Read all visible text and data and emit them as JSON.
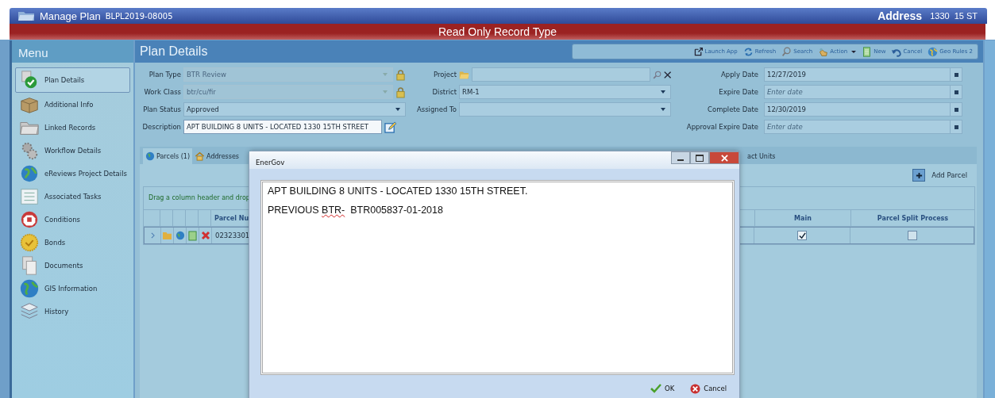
{
  "window": {
    "title": "Manage Plan",
    "record": "BLPL2019-08005",
    "address_label": "Address",
    "address_number": "1330",
    "address_street": "15 ST"
  },
  "banner": "Read Only Record Type",
  "menu": {
    "title": "Menu",
    "items": [
      {
        "label": "Plan Details",
        "selected": true
      },
      {
        "label": "Additional Info",
        "selected": false
      },
      {
        "label": "Linked Records",
        "selected": false
      },
      {
        "label": "Workflow Details",
        "selected": false
      },
      {
        "label": "eReviews Project Details",
        "selected": false
      },
      {
        "label": "Associated Tasks",
        "selected": false
      },
      {
        "label": "Conditions",
        "selected": false
      },
      {
        "label": "Bonds",
        "selected": false
      },
      {
        "label": "Documents",
        "selected": false
      },
      {
        "label": "GIS Information",
        "selected": false
      },
      {
        "label": "History",
        "selected": false
      }
    ]
  },
  "section_title": "Plan Details",
  "toolbar": [
    {
      "label": "Launch App",
      "dropdown": false
    },
    {
      "label": "Refresh",
      "dropdown": false
    },
    {
      "label": "Search",
      "dropdown": false
    },
    {
      "label": "Action",
      "dropdown": true
    },
    {
      "label": "New",
      "dropdown": false
    },
    {
      "label": "Cancel",
      "dropdown": false
    },
    {
      "label": "Geo Rules 2",
      "dropdown": false
    }
  ],
  "form": {
    "columns": [
      [
        {
          "kind": "select",
          "label": "Plan Type",
          "value": "BTR Review",
          "disabled": true,
          "locked": true
        },
        {
          "kind": "select",
          "label": "Work Class",
          "value": "btr/cu/fir",
          "disabled": true,
          "locked": true
        },
        {
          "kind": "select",
          "label": "Plan Status",
          "value": "Approved",
          "disabled": false,
          "locked": false
        },
        {
          "kind": "text",
          "label": "Description",
          "value": "APT BUILDING 8 UNITS - LOCATED 1330 15TH STREET",
          "disabled": false,
          "locked": false
        }
      ],
      [
        {
          "kind": "lookup",
          "label": "Project",
          "disabled": false,
          "locked": false
        },
        {
          "kind": "select",
          "label": "District",
          "value": "RM-1",
          "disabled": false,
          "locked": false
        },
        {
          "kind": "select",
          "label": "Assigned To",
          "disabled": false,
          "locked": false
        }
      ],
      [
        {
          "kind": "date",
          "label": "Apply Date",
          "value": "12/27/2019",
          "disabled": false,
          "locked": false
        },
        {
          "kind": "date",
          "label": "Expire Date",
          "placeholder": "Enter date",
          "disabled": false,
          "locked": false
        },
        {
          "kind": "date",
          "label": "Complete Date",
          "value": "12/30/2019",
          "disabled": false,
          "locked": false
        },
        {
          "kind": "date",
          "label": "Approval Expire Date",
          "placeholder": "Enter date",
          "disabled": false,
          "locked": false
        }
      ]
    ]
  },
  "tabs": [
    {
      "label": "Parcels (1)",
      "selected": true
    },
    {
      "label": "Addresses",
      "selected": false
    },
    {
      "label": "act Units",
      "selected": false
    }
  ],
  "add_button": "Add Parcel",
  "grid": {
    "group_hint": "Drag a column header and drop",
    "columns": [
      "Parcel Nu",
      "Main",
      "Parcel Split Process"
    ],
    "rows": [
      {
        "parcel": "02323301",
        "main": true,
        "split": false
      }
    ]
  },
  "dialog": {
    "title": "EnerGov",
    "paragraphs": [
      [
        {
          "text": "APT BUILDING 8 UNITS - LOCATED 1330 15TH STREET.",
          "misspelled": false
        }
      ],
      [
        {
          "text": "PREVIOUS ",
          "misspelled": false
        },
        {
          "text": "BTR-",
          "misspelled": true
        },
        {
          "text": "  BTR005837-01-2018",
          "misspelled": false
        }
      ]
    ],
    "ok": "OK",
    "cancel": "Cancel"
  }
}
